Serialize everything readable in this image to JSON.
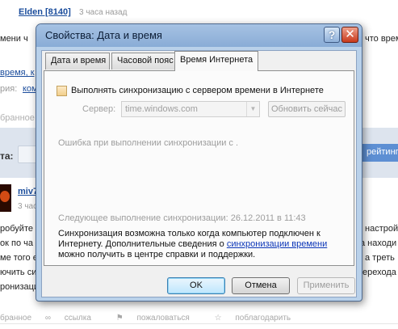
{
  "background": {
    "author1": "Elden [8140]",
    "time1": "3 часа назад",
    "line1_left": "мени ч",
    "line1_right": "что время",
    "tags_fragment": "время, к",
    "category_label": "рия:",
    "category_link": "ком",
    "favorite_faint": "бранное",
    "band_label": "та:",
    "rate_button": "рейтингу",
    "author2": "miv7",
    "time2": "3 часа",
    "para_left": [
      "робуйте",
      "ок по ча",
      "ме того е",
      "ючить си",
      "ронизаци"
    ],
    "para_right": [
      "настрой",
      "а находи",
      "а треть",
      "ерехода"
    ],
    "actions": [
      "бранное",
      "ссылка",
      "пожаловаться",
      "поблагодарить"
    ]
  },
  "dialog": {
    "title": "Свойства: Дата и время",
    "help_symbol": "?",
    "close_symbol": "✕",
    "tabs": [
      {
        "label": "Дата и время"
      },
      {
        "label": "Часовой пояс"
      },
      {
        "label": "Время Интернета"
      }
    ],
    "sync_checkbox_label": "Выполнять синхронизацию с сервером времени в Интернете",
    "server_label": "Сервер:",
    "server_value": "time.windows.com",
    "update_button": "Обновить сейчас",
    "error_text": "Ошибка при выполнении синхронизации с .",
    "next_sync_text": "Следующее выполнение синхронизации: 26.12.2011 в 11:43",
    "info_text_before": "Синхронизация возможна только когда компьютер подключен к Интернету. Дополнительные сведения о ",
    "info_link": "синхронизации времени",
    "info_text_after": " можно получить в центре справки и поддержки.",
    "buttons": {
      "ok": "OK",
      "cancel": "Отмена",
      "apply": "Применить"
    }
  }
}
